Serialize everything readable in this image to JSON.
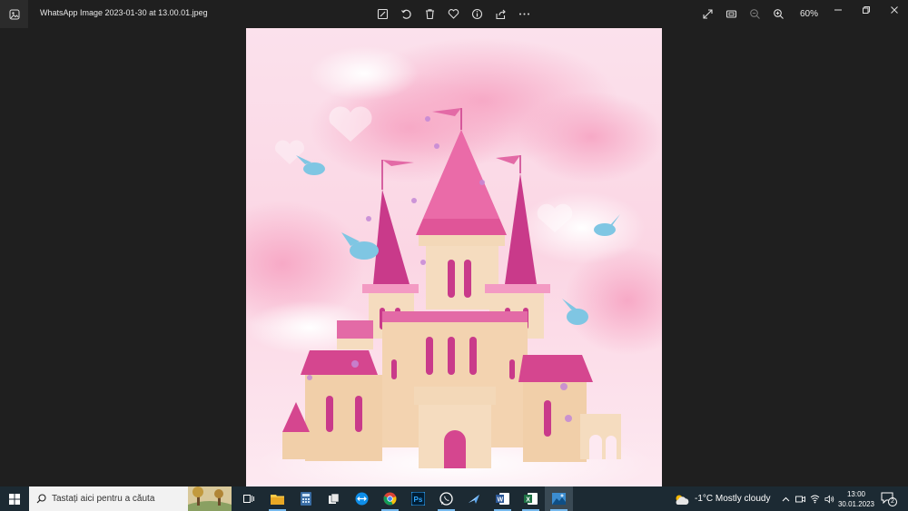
{
  "window": {
    "title": "WhatsApp Image 2023-01-30 at 13.00.01.jpeg",
    "zoom": "60%"
  },
  "toolbar": {
    "items": [
      "edit-image-icon",
      "rotate-icon",
      "delete-icon",
      "favorite-icon",
      "info-icon",
      "share-icon",
      "more-icon"
    ]
  },
  "right_tools": [
    "fullscreen-icon",
    "slideshow-icon",
    "zoom-out-icon",
    "zoom-in-icon"
  ],
  "taskbar": {
    "search_placeholder": "Tastați aici pentru a căuta",
    "apps": [
      "task-view",
      "file-explorer",
      "calculator",
      "files",
      "teamviewer",
      "chrome",
      "photoshop",
      "whatsapp",
      "messenger",
      "word",
      "excel",
      "photos"
    ],
    "weather": "-1°C  Mostly cloudy",
    "time": "13:00",
    "date": "30.01.2023",
    "notifications": "2"
  },
  "colors": {
    "titlebar": "#1f1f1f",
    "taskbar": "#1c2a33",
    "accent": "#76b9ed"
  }
}
